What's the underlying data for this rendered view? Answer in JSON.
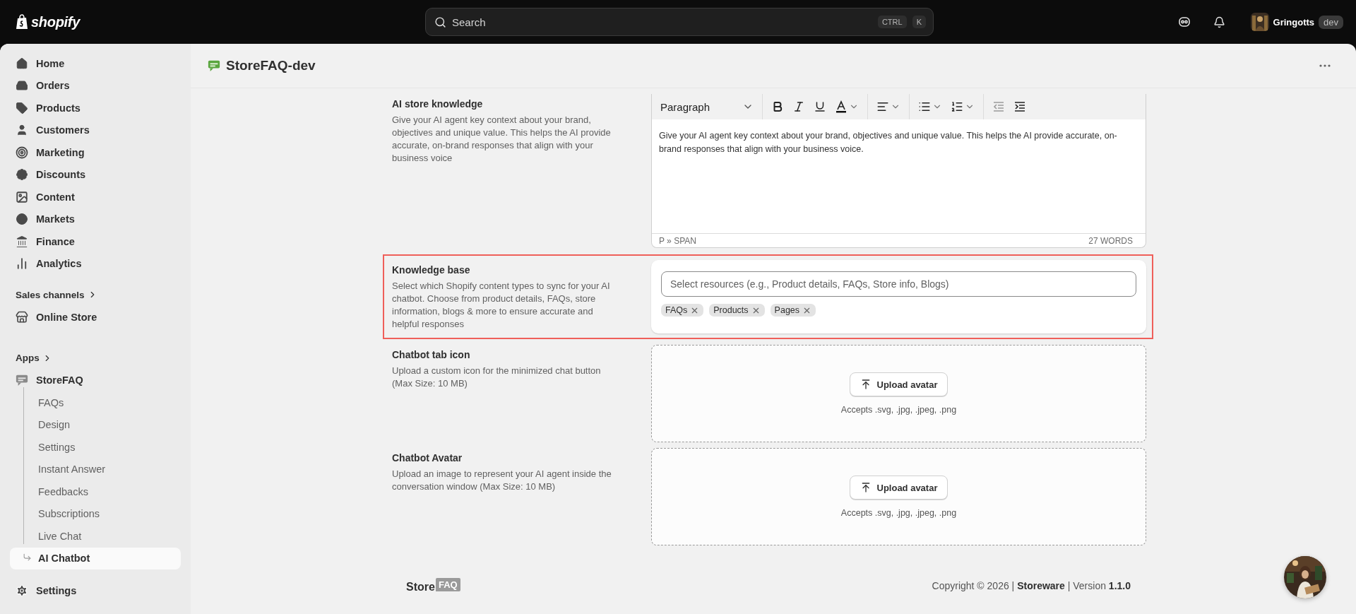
{
  "topbar": {
    "logo": "shopify",
    "search": {
      "placeholder": "Search",
      "keys": [
        "CTRL",
        "K"
      ]
    },
    "user": {
      "name": "Gringotts",
      "badge": "dev"
    }
  },
  "sidebar": {
    "nav": [
      {
        "label": "Home",
        "selected": false
      },
      {
        "label": "Orders",
        "selected": false
      },
      {
        "label": "Products",
        "selected": false
      },
      {
        "label": "Customers",
        "selected": false
      },
      {
        "label": "Marketing",
        "selected": false
      },
      {
        "label": "Discounts",
        "selected": false
      },
      {
        "label": "Content",
        "selected": false
      },
      {
        "label": "Markets",
        "selected": false
      },
      {
        "label": "Finance",
        "selected": false
      },
      {
        "label": "Analytics",
        "selected": false
      }
    ],
    "sales_channels": {
      "heading": "Sales channels",
      "items": [
        {
          "label": "Online Store",
          "selected": false
        }
      ]
    },
    "apps": {
      "heading": "Apps",
      "app": {
        "label": "StoreFAQ",
        "children": [
          {
            "label": "FAQs",
            "selected": false
          },
          {
            "label": "Design",
            "selected": false
          },
          {
            "label": "Settings",
            "selected": false
          },
          {
            "label": "Instant Answer",
            "selected": false
          },
          {
            "label": "Feedbacks",
            "selected": false
          },
          {
            "label": "Subscriptions",
            "selected": false
          },
          {
            "label": "Live Chat",
            "selected": false
          },
          {
            "label": "AI Chatbot",
            "selected": true
          }
        ]
      }
    },
    "settings": {
      "label": "Settings",
      "selected": false
    }
  },
  "page": {
    "title": "StoreFAQ-dev",
    "sections": [
      {
        "kind": "editor",
        "title": "AI store knowledge",
        "description": "Give your AI agent key context about your brand, objectives and unique value. This helps the AI provide accurate, on-brand responses that align with your business voice",
        "highlighted": false,
        "editor": {
          "block_format": "Paragraph",
          "outdent_disabled": true,
          "content": "Give your AI agent key context about your brand, objectives and unique value. This helps the AI provide accurate, on-brand responses that align with your business voice.",
          "path": "P » SPAN",
          "word_count": "27 WORDS"
        }
      },
      {
        "kind": "resources",
        "title": "Knowledge base",
        "description": "Select which Shopify content types to sync for your AI chatbot. Choose from product details, FAQs, store information, blogs & more to ensure accurate and helpful responses",
        "highlighted": true,
        "placeholder": "Select resources (e.g., Product details, FAQs, Store info, Blogs)",
        "tags": [
          "FAQs",
          "Products",
          "Pages"
        ]
      },
      {
        "kind": "upload",
        "title": "Chatbot tab icon",
        "description": "Upload a custom icon for the minimized chat button (Max Size: 10 MB)",
        "highlighted": false,
        "button": "Upload avatar",
        "hint": "Accepts .svg, .jpg, .jpeg, .png"
      },
      {
        "kind": "upload",
        "title": "Chatbot Avatar",
        "description": "Upload an image to represent your AI agent inside the conversation window (Max Size: 10 MB)",
        "highlighted": false,
        "button": "Upload avatar",
        "hint": "Accepts .svg, .jpg, .jpeg, .png"
      }
    ]
  },
  "footer": {
    "logo_text": "Store",
    "logo_badge": "FAQ",
    "copyright": "Copyright © 2026 | **Storeware** | Version **1.1.0**"
  }
}
